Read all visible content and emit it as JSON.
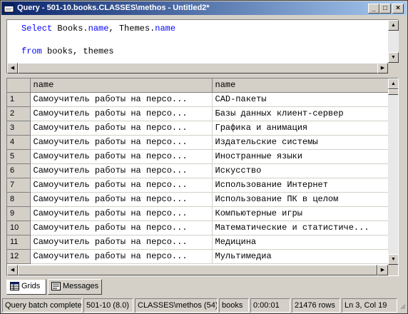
{
  "window": {
    "title": "Query - 501-10.books.CLASSES\\methos - Untitled2*"
  },
  "editor": {
    "line1": {
      "kw": "Select",
      "rest_a": " Books.",
      "kw2": "name",
      "rest_b": ", Themes.",
      "kw3": "name"
    },
    "line3": {
      "kw": "from",
      "rest": " books, themes"
    }
  },
  "grid": {
    "columns": [
      "name",
      "name"
    ],
    "rows": [
      [
        "1",
        "Самоучитель работы на персо...",
        "CAD-пакеты"
      ],
      [
        "2",
        "Самоучитель работы на персо...",
        "Базы данных клиент-сервер"
      ],
      [
        "3",
        "Самоучитель работы на персо...",
        "Графика и анимация"
      ],
      [
        "4",
        "Самоучитель работы на персо...",
        "Издательские системы"
      ],
      [
        "5",
        "Самоучитель работы на персо...",
        "Иностранные языки"
      ],
      [
        "6",
        "Самоучитель работы на персо...",
        "Искусство"
      ],
      [
        "7",
        "Самоучитель работы на персо...",
        "Использование Интернет"
      ],
      [
        "8",
        "Самоучитель работы на персо...",
        "Использование ПК в целом"
      ],
      [
        "9",
        "Самоучитель работы на персо...",
        "Компьютерные игры"
      ],
      [
        "10",
        "Самоучитель работы на персо...",
        "Математические и статистиче..."
      ],
      [
        "11",
        "Самоучитель работы на персо...",
        "Медицина"
      ],
      [
        "12",
        "Самоучитель работы на персо...",
        "Мультимедиа"
      ]
    ]
  },
  "tabs": {
    "grids": "Grids",
    "messages": "Messages"
  },
  "status": {
    "message": "Query batch completed",
    "server": "501-10 (8.0)",
    "user": "CLASSES\\methos (54)",
    "database": "books",
    "elapsed": "0:00:01",
    "rows": "21476 rows",
    "position": "Ln 3, Col 19"
  },
  "colors": {
    "titlebar_start": "#0a246a",
    "titlebar_end": "#a6caf0",
    "keyword": "#0000ff"
  }
}
